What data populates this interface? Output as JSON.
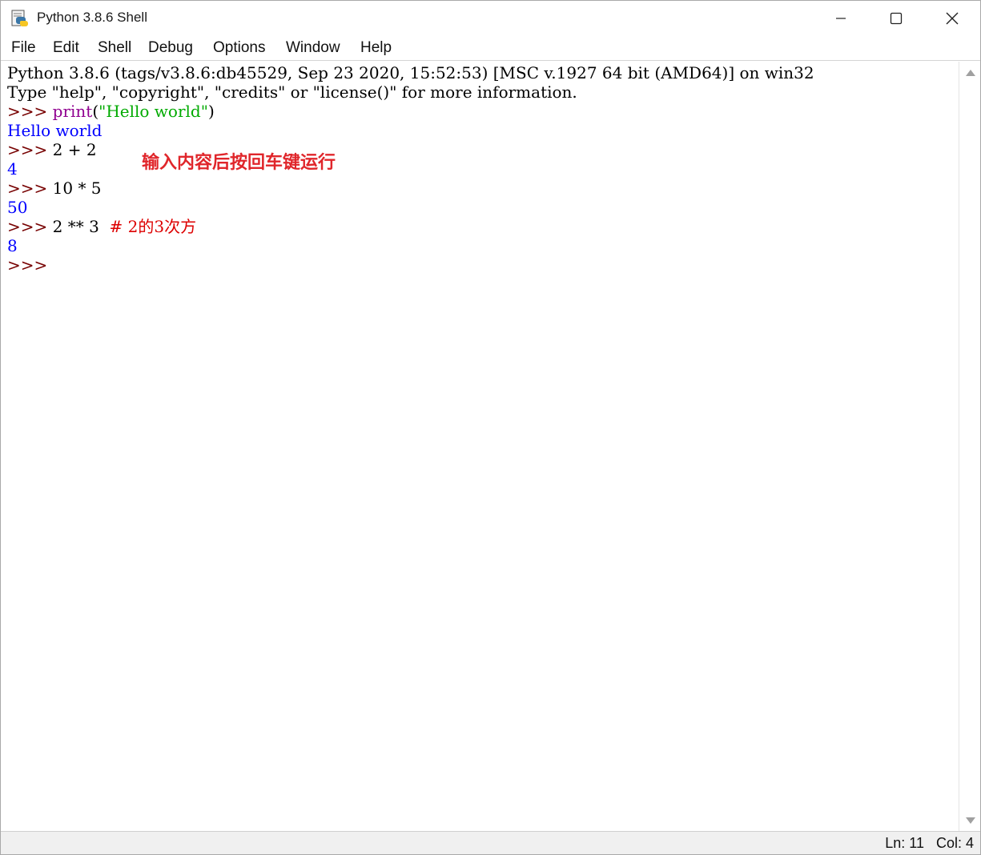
{
  "window": {
    "title": "Python 3.8.6 Shell",
    "icon": "python-idle-icon",
    "controls": [
      "minimize-icon",
      "maximize-icon",
      "close-icon"
    ]
  },
  "menu": {
    "items": [
      "File",
      "Edit",
      "Shell",
      "Debug",
      "Options",
      "Window",
      "Help"
    ]
  },
  "shell": {
    "banner1": "Python 3.8.6 (tags/v3.8.6:db45529, Sep 23 2020, 15:52:53) [MSC v.1927 64 bit (AMD64)] on win32",
    "banner2": "Type \"help\", \"copyright\", \"credits\" or \"license()\" for more information.",
    "prompt": ">>> ",
    "cmd1_func": "print",
    "cmd1_open": "(",
    "cmd1_str": "\"Hello world\"",
    "cmd1_close": ")",
    "out1": "Hello world",
    "cmd2": "2 + 2",
    "out2": "4",
    "cmd3": "10 * 5",
    "out3": "50",
    "cmd4": "2 ** 3  ",
    "cmd4_comment": "# 2的3次方",
    "out4": "8",
    "final_prompt": ">>>"
  },
  "annotation": {
    "text": "输入内容后按回车键运行",
    "color": "#e0262b"
  },
  "status": {
    "ln": "Ln: 11",
    "col": "Col: 4"
  },
  "colors": {
    "prompt": "#770000",
    "stdout": "#0000ff",
    "builtin": "#900090",
    "string": "#00aa00",
    "comment": "#dd0000"
  }
}
